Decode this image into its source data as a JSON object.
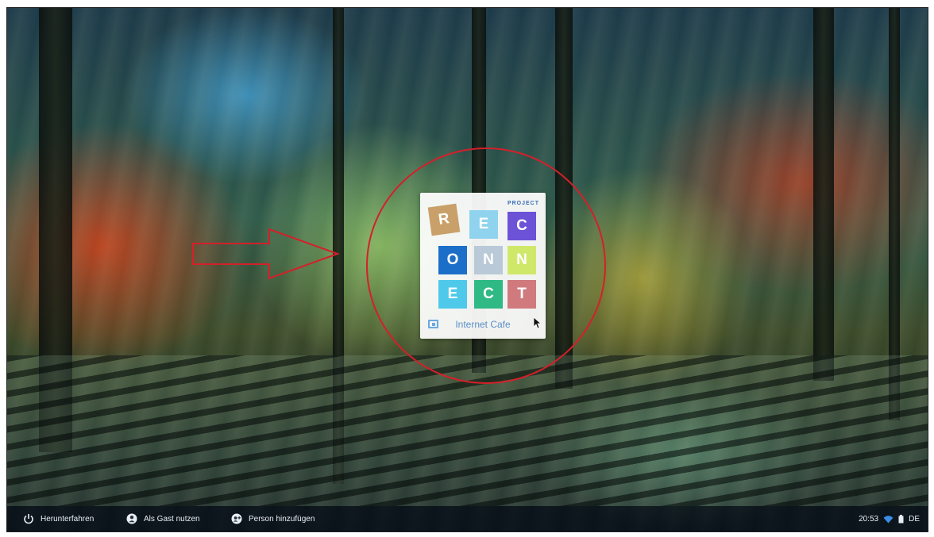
{
  "login_pod": {
    "brand_tag": "PROJECT",
    "tiles": [
      {
        "letter": "R",
        "color": "#c9a06a"
      },
      {
        "letter": "E",
        "color": "#8fd3ee"
      },
      {
        "letter": "C",
        "color": "#6b52d6"
      },
      {
        "letter": "O",
        "color": "#1c6fc8"
      },
      {
        "letter": "N",
        "color": "#b9c9d8"
      },
      {
        "letter": "N",
        "color": "#cfe86a"
      },
      {
        "letter": "E",
        "color": "#4fc9ea"
      },
      {
        "letter": "C",
        "color": "#2fb984"
      },
      {
        "letter": "T",
        "color": "#d07a7e"
      }
    ],
    "user_name": "Internet Cafe"
  },
  "annotation": {
    "circle_color": "#d4202a",
    "arrow_color": "#d4202a"
  },
  "shelf": {
    "shutdown_label": "Herunterfahren",
    "guest_label": "Als Gast nutzen",
    "add_person_label": "Person hinzufügen",
    "time": "20:53",
    "keyboard_layout": "DE",
    "icons": [
      "power-icon",
      "guest-icon",
      "add-person-icon",
      "wifi-icon",
      "battery-icon"
    ]
  }
}
